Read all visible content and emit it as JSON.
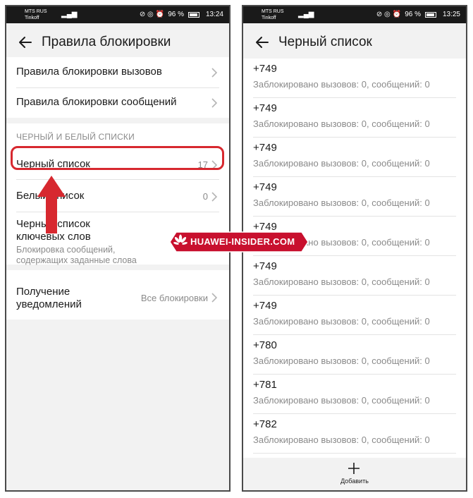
{
  "left_screen": {
    "status": {
      "carrier_1": "MTS RUS",
      "carrier_2": "Tinkoff",
      "battery": "96 %",
      "time": "13:24"
    },
    "title": "Правила блокировки",
    "items": [
      {
        "label": "Правила блокировки вызовов"
      },
      {
        "label": "Правила блокировки сообщений"
      }
    ],
    "section_header": "ЧЕРНЫЙ И БЕЛЫЙ СПИСКИ",
    "blacklist": {
      "label": "Черный список",
      "count": "17"
    },
    "whitelist": {
      "label": "Белый список",
      "count": "0"
    },
    "keyword_list": {
      "label_line1": "Черный список",
      "label_line2": "ключевых слов",
      "desc_line1": "Блокировка сообщений,",
      "desc_line2": "содержащих заданные слова"
    },
    "notifications": {
      "label_line1": "Получение",
      "label_line2": "уведомлений",
      "value": "Все блокировки"
    }
  },
  "right_screen": {
    "status": {
      "carrier_1": "MTS RUS",
      "carrier_2": "Tinkoff",
      "battery": "96 %",
      "time": "13:25"
    },
    "title": "Черный список",
    "entries": [
      {
        "number": "+749",
        "stats": "Заблокировано вызовов: 0, сообщений: 0"
      },
      {
        "number": "+749",
        "stats": "Заблокировано вызовов: 0, сообщений: 0"
      },
      {
        "number": "+749",
        "stats": "Заблокировано вызовов: 0, сообщений: 0"
      },
      {
        "number": "+749",
        "stats": "Заблокировано вызовов: 0, сообщений: 0"
      },
      {
        "number": "+749",
        "stats": "Заблокировано вызовов: 0, сообщений: 0"
      },
      {
        "number": "+749",
        "stats": "Заблокировано вызовов: 0, сообщений: 0"
      },
      {
        "number": "+749",
        "stats": "Заблокировано вызовов: 0, сообщений: 0"
      },
      {
        "number": "+780",
        "stats": "Заблокировано вызовов: 0, сообщений: 0"
      },
      {
        "number": "+781",
        "stats": "Заблокировано вызовов: 0, сообщений: 0"
      },
      {
        "number": "+782",
        "stats": "Заблокировано вызовов: 0, сообщений: 0"
      }
    ],
    "add_label": "Добавить"
  },
  "watermark": {
    "text": "HUAWEI-INSIDER.COM"
  },
  "colors": {
    "highlight": "#d7282f",
    "arrow": "#d7282f",
    "watermark_bg": "#c8102e"
  }
}
